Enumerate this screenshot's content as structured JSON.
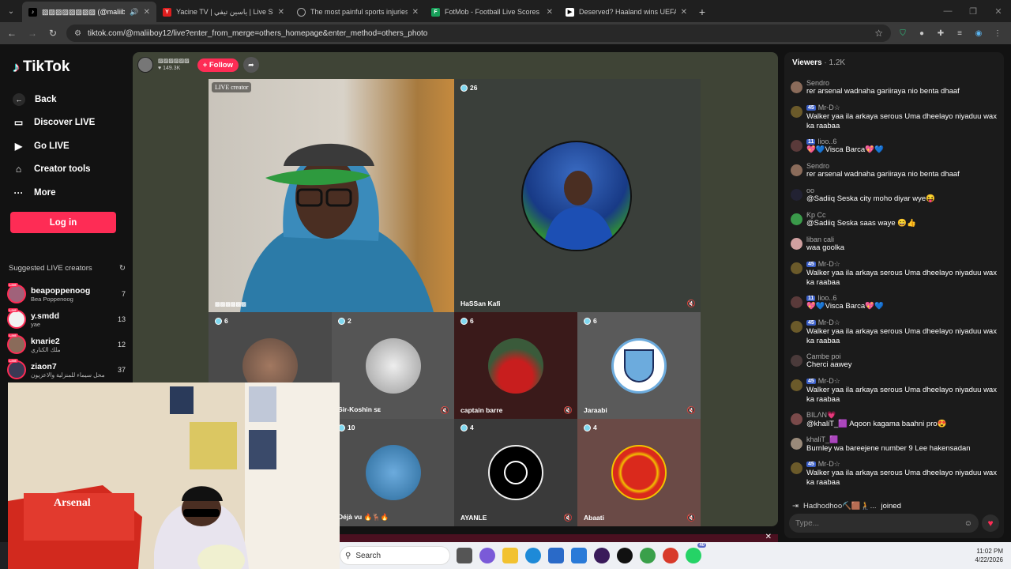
{
  "browser": {
    "tabs": [
      {
        "title": "▨▨▨▨▨▨▨▨ (@maliiboy1",
        "favicon": "tiktok",
        "active": true
      },
      {
        "title": "Yacine TV | ياسين تيفي | Live Stre",
        "favicon": "Y"
      },
      {
        "title": "The most painful sports injuries",
        "favicon": "globe"
      },
      {
        "title": "FotMob - Football Live Scores",
        "favicon": "fotmob"
      },
      {
        "title": "Deserved? Haaland wins UEFA P",
        "favicon": "news"
      }
    ],
    "url": "tiktok.com/@maliiboy12/live?enter_from_merge=others_homepage&enter_method=others_photo"
  },
  "sidebar": {
    "logo": "TikTok",
    "nav": [
      {
        "label": "Back",
        "icon": "arrow-left-icon"
      },
      {
        "label": "Discover LIVE",
        "icon": "tv-icon"
      },
      {
        "label": "Go LIVE",
        "icon": "camera-icon"
      },
      {
        "label": "Creator tools",
        "icon": "home-icon"
      },
      {
        "label": "More",
        "icon": "more-icon"
      }
    ],
    "login": "Log in",
    "suggested_title": "Suggested LIVE creators",
    "creators": [
      {
        "name": "beapoppenoog",
        "sub": "Bea Poppenoog",
        "count": "7",
        "color": "#a0627a"
      },
      {
        "name": "y.smdd",
        "sub": "yae",
        "count": "13",
        "color": "#f2f2f2"
      },
      {
        "name": "knarie2",
        "sub": "ملك الكناري",
        "count": "12",
        "color": "#8a6b5a"
      },
      {
        "name": "ziaon7",
        "sub": "محل سيماء للمنزلية والاعزيون",
        "count": "37",
        "color": "#3a3a55"
      }
    ]
  },
  "host": {
    "name": "▨▨▨▨▨▨",
    "likes": "149.3K",
    "follow": "+ Follow"
  },
  "stage": {
    "main_label": "LIVE creator",
    "main_name": "▨▨▨▨▨▨",
    "guest1": {
      "count": "26",
      "name": "HaSSan Kafi"
    },
    "cells": [
      {
        "count": "6",
        "name": ""
      },
      {
        "count": "2",
        "name": "Sir-Koshin ꜱᴇ"
      },
      {
        "count": "6",
        "name": "captain barre"
      },
      {
        "count": "6",
        "name": "Jaraabi"
      },
      {
        "count": "10",
        "name": "Déjà vu 🔥🦌🔥"
      },
      {
        "count": "4",
        "name": "AYANLE"
      },
      {
        "count": "4",
        "name": "Abaati"
      }
    ]
  },
  "chat": {
    "title": "Viewers",
    "viewers": "· 1.2K",
    "messages": [
      {
        "user": "Sendro",
        "level": "",
        "text": "rer arsenal wadnaha gariiraya nio benta dhaaf",
        "color": "#8a6b5a"
      },
      {
        "user": "Mr-D☆",
        "level": "45",
        "text": "Walker yaa ila arkaya serous Uma dheelayo niyaduu wax ka raabaa",
        "color": "#6b5a2a"
      },
      {
        "user": "lioo..6",
        "level": "11",
        "text": "💖💙Visca Barca💖💙",
        "color": "#5a3a3a"
      },
      {
        "user": "Sendro",
        "level": "",
        "text": "rer arsenal wadnaha gariiraya nio benta dhaaf",
        "color": "#8a6b5a"
      },
      {
        "user": "oo",
        "level": "",
        "text": "@Sadiiq Seska city moho diyar wye😝",
        "color": "#222233"
      },
      {
        "user": "Ƙp Cc",
        "level": "",
        "text": "@Sadiiq Seska saas waye 😄👍",
        "color": "#3a9a4a"
      },
      {
        "user": "liban cali",
        "level": "",
        "text": "waa goolka",
        "color": "#d0a0a0"
      },
      {
        "user": "Mr-D☆",
        "level": "45",
        "text": "Walker yaa ila arkaya serous Uma dheelayo niyaduu wax ka raabaa",
        "color": "#6b5a2a"
      },
      {
        "user": "lioo..6",
        "level": "11",
        "text": "💖💙Visca Barca💖💙",
        "color": "#5a3a3a"
      },
      {
        "user": "Mr-D☆",
        "level": "45",
        "text": "Walker yaa ila arkaya serous Uma dheelayo niyaduu wax ka raabaa",
        "color": "#6b5a2a"
      },
      {
        "user": "Cambe poi",
        "level": "",
        "text": "Cherci aawey",
        "color": "#4a3a3a"
      },
      {
        "user": "Mr-D☆",
        "level": "45",
        "text": "Walker yaa ila arkaya serous Uma dheelayo niyaduu wax ka raabaa",
        "color": "#6b5a2a"
      },
      {
        "user": "BILΛN💗",
        "level": "",
        "text": "@khaliT_🟪 Aqoon kagama baahni pro😍",
        "color": "#7a4a4a"
      },
      {
        "user": "khaliT_🟪",
        "level": "",
        "text": "Burnley wa bareejene number 9 Lee hakensadan",
        "color": "#9a8a7a"
      },
      {
        "user": "Mr-D☆",
        "level": "45",
        "text": "Walker yaa ila arkaya serous Uma dheelayo niyaduu wax ka raabaa",
        "color": "#6b5a2a"
      }
    ],
    "joined_user": "Hadhodhoo⛏️🟫🧎...",
    "joined_text": "joined",
    "placeholder": "Type..."
  },
  "taskbar": {
    "search": "Search",
    "time": "11:02 PM",
    "date": "4/22/2026",
    "badge": "40"
  }
}
